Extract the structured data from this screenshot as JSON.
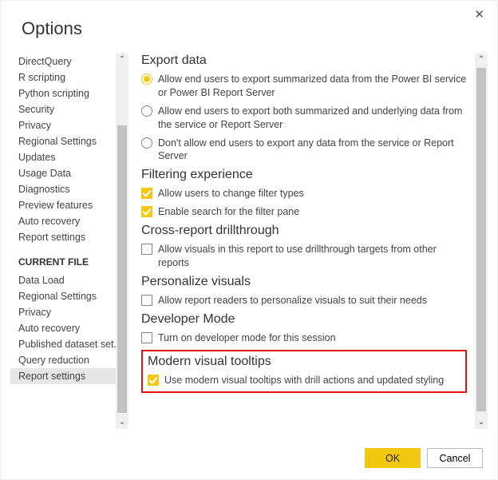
{
  "dialog": {
    "title": "Options",
    "ok_label": "OK",
    "cancel_label": "Cancel"
  },
  "sidebar": {
    "global_items": [
      "DirectQuery",
      "R scripting",
      "Python scripting",
      "Security",
      "Privacy",
      "Regional Settings",
      "Updates",
      "Usage Data",
      "Diagnostics",
      "Preview features",
      "Auto recovery",
      "Report settings"
    ],
    "section_header": "CURRENT FILE",
    "file_items": [
      "Data Load",
      "Regional Settings",
      "Privacy",
      "Auto recovery",
      "Published dataset set...",
      "Query reduction",
      "Report settings"
    ],
    "selected": "Report settings"
  },
  "content": {
    "export": {
      "title": "Export data",
      "opt1": "Allow end users to export summarized data from the Power BI service or Power BI Report Server",
      "opt2": "Allow end users to export both summarized and underlying data from the service or Report Server",
      "opt3": "Don't allow end users to export any data from the service or Report Server",
      "selected": 0
    },
    "filtering": {
      "title": "Filtering experience",
      "opt1": "Allow users to change filter types",
      "opt2": "Enable search for the filter pane",
      "chk1": true,
      "chk2": true
    },
    "crossreport": {
      "title": "Cross-report drillthrough",
      "opt1": "Allow visuals in this report to use drillthrough targets from other reports",
      "chk1": false
    },
    "personalize": {
      "title": "Personalize visuals",
      "opt1": "Allow report readers to personalize visuals to suit their needs",
      "chk1": false
    },
    "devmode": {
      "title": "Developer Mode",
      "opt1": "Turn on developer mode for this session",
      "chk1": false
    },
    "tooltips": {
      "title": "Modern visual tooltips",
      "opt1": "Use modern visual tooltips with drill actions and updated styling",
      "chk1": true
    }
  }
}
